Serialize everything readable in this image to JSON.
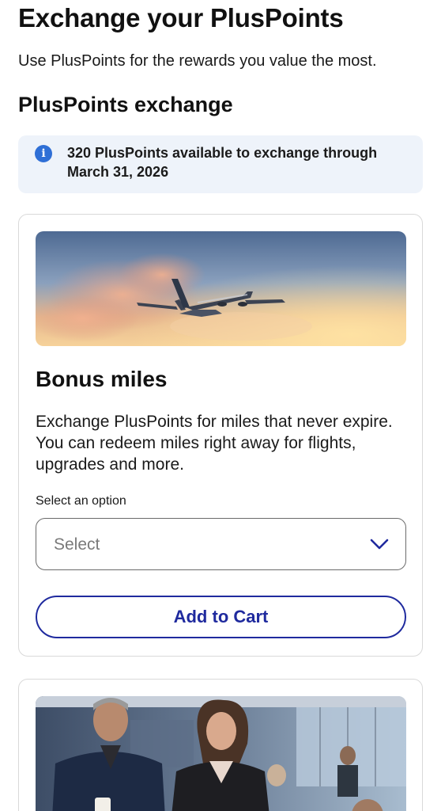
{
  "header": {
    "title": "Exchange your PlusPoints",
    "subtitle": "Use PlusPoints for the rewards you value the most."
  },
  "section": {
    "title": "PlusPoints exchange"
  },
  "info_banner": {
    "icon": "info-icon",
    "text": "320 PlusPoints available to exchange through March 31, 2026"
  },
  "cards": [
    {
      "image": "airplane-sunset-photo",
      "heading": "Bonus miles",
      "description": "Exchange PlusPoints for miles that never expire. You can redeem miles right away for flights, upgrades and more.",
      "select_label": "Select an option",
      "select_value": "Select",
      "select_icon": "chevron-down-icon",
      "button_label": "Add to Cart"
    },
    {
      "image": "travelers-in-lounge-photo"
    }
  ],
  "colors": {
    "accent": "#1f2a9e",
    "info_icon": "#2f6fd6",
    "banner_background": "#eef3fa",
    "card_border": "#d9d9d9"
  }
}
